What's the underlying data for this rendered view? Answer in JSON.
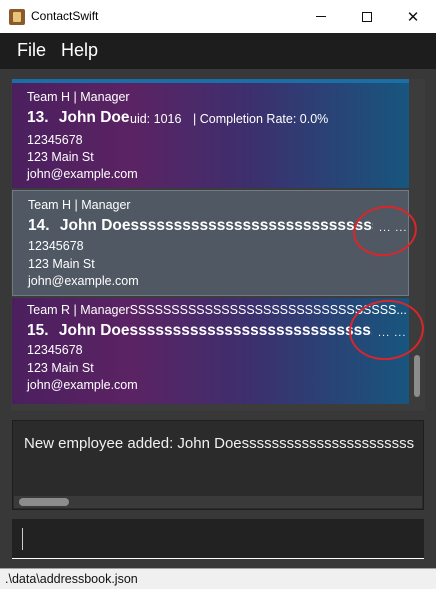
{
  "window": {
    "title": "ContactSwift",
    "close_glyph": "✕",
    "icon": "app-icon"
  },
  "menu": {
    "file": "File",
    "help": "Help"
  },
  "persons": [
    {
      "team": "Team H | Manager",
      "index": "13.",
      "name": "John Doe",
      "uid": "uid: 1016",
      "completion": "| Completion Rate: 0.0%",
      "phone": "12345678",
      "address": "123 Main St",
      "email": "john@example.com",
      "selected": false
    },
    {
      "team": "Team H | Manager",
      "index": "14.",
      "name": "John Doesssssssssssssssssssssssssssss...",
      "ellipsis": "... ...",
      "phone": "12345678",
      "address": "123 Main St",
      "email": "john@example.com",
      "selected": true
    },
    {
      "team": "Team R | ManagerSSSSSSSSSSSSSSSSSSSSSSSSSSSSSSSS...",
      "index": "15.",
      "name": "John Doessssssssssssssssssssssssssss...",
      "ellipsis": "... ...",
      "phone": "12345678",
      "address": "123 Main St",
      "email": "john@example.com",
      "selected": false
    }
  ],
  "result": {
    "message": "New employee added: John Doesssssssssssssssssssssss"
  },
  "command": {
    "value": ""
  },
  "status": {
    "path": ".\\data\\addressbook.json"
  },
  "colors": {
    "annotation": "#d9262b",
    "card_gradient_start": "#4b1f5e",
    "card_gradient_end": "#17567e",
    "selected_card": "#4f5863",
    "background": "#2b2b2b"
  }
}
